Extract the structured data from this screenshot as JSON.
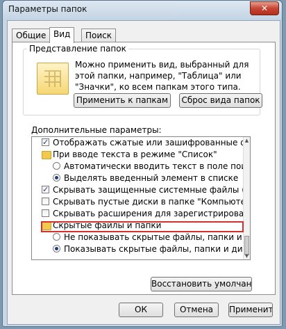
{
  "window": {
    "title": "Параметры папок",
    "close_label": "✕"
  },
  "tabs": [
    {
      "label": "Общие"
    },
    {
      "label": "Вид"
    },
    {
      "label": "Поиск"
    }
  ],
  "folder_view": {
    "group_title": "Представление папок",
    "description": "Можно применить вид, выбранный для этой папки, например, \"Таблица\" или \"Значки\", ко всем папкам этого типа.",
    "apply_button": "Применить к папкам",
    "reset_button": "Сброс вида папок"
  },
  "advanced": {
    "label": "Дополнительные параметры:",
    "items": [
      {
        "type": "checkbox",
        "checked": true,
        "text": "Отображать сжатые или зашифрованные файлы NTFS"
      },
      {
        "type": "folder",
        "text": "При вводе текста в режиме \"Список\""
      },
      {
        "type": "radio",
        "checked": false,
        "text": "Автоматически вводить текст в поле поиска"
      },
      {
        "type": "radio",
        "checked": true,
        "text": "Выделять введенный элемент в списке"
      },
      {
        "type": "checkbox",
        "checked": true,
        "text": "Скрывать защищенные системные файлы (рекомендуется)"
      },
      {
        "type": "checkbox",
        "checked": false,
        "text": "Скрывать пустые диски в папке \"Компьютер\""
      },
      {
        "type": "checkbox",
        "checked": false,
        "text": "Скрывать расширения для зарегистрированных типов"
      },
      {
        "type": "folder",
        "text": "Скрытые файлы и папки"
      },
      {
        "type": "radio",
        "checked": false,
        "text": "Не показывать скрытые файлы, папки и диски"
      },
      {
        "type": "radio",
        "checked": true,
        "text": "Показывать скрытые файлы, папки и диски"
      }
    ]
  },
  "restore_button": "Восстановить умолчания",
  "footer": {
    "ok": "ОК",
    "cancel": "Отмена",
    "apply": "Применить"
  },
  "colors": {
    "highlight_border": "#d4312e"
  }
}
